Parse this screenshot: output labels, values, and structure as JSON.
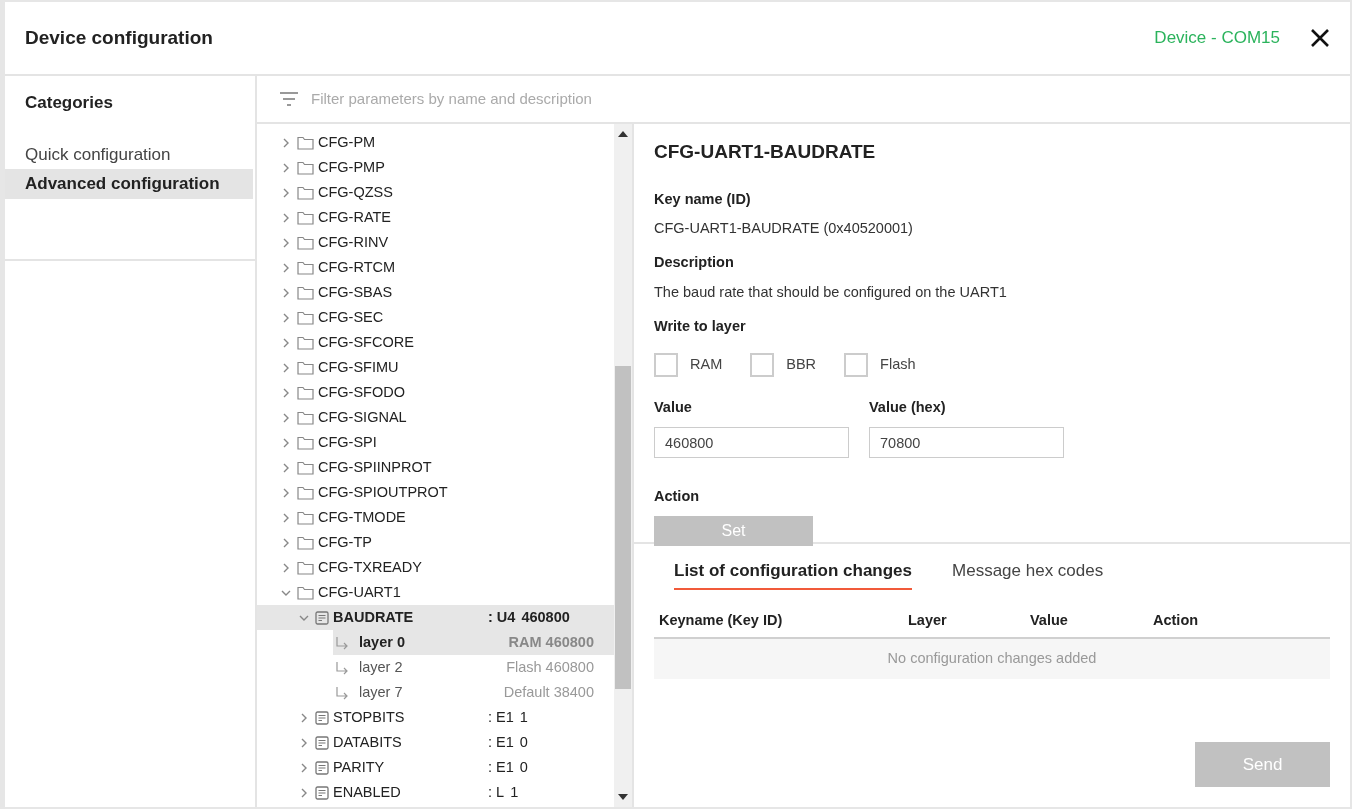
{
  "window": {
    "title": "Device configuration",
    "device": "Device - COM15"
  },
  "sidebar": {
    "title": "Categories",
    "items": [
      {
        "label": "Quick configuration",
        "selected": false
      },
      {
        "label": "Advanced configuration",
        "selected": true
      }
    ]
  },
  "filter": {
    "placeholder": "Filter parameters by name and description"
  },
  "tree": [
    {
      "kind": "folder",
      "label": "CFG-PM",
      "expanded": false
    },
    {
      "kind": "folder",
      "label": "CFG-PMP",
      "expanded": false
    },
    {
      "kind": "folder",
      "label": "CFG-QZSS",
      "expanded": false
    },
    {
      "kind": "folder",
      "label": "CFG-RATE",
      "expanded": false
    },
    {
      "kind": "folder",
      "label": "CFG-RINV",
      "expanded": false
    },
    {
      "kind": "folder",
      "label": "CFG-RTCM",
      "expanded": false
    },
    {
      "kind": "folder",
      "label": "CFG-SBAS",
      "expanded": false
    },
    {
      "kind": "folder",
      "label": "CFG-SEC",
      "expanded": false
    },
    {
      "kind": "folder",
      "label": "CFG-SFCORE",
      "expanded": false
    },
    {
      "kind": "folder",
      "label": "CFG-SFIMU",
      "expanded": false
    },
    {
      "kind": "folder",
      "label": "CFG-SFODO",
      "expanded": false
    },
    {
      "kind": "folder",
      "label": "CFG-SIGNAL",
      "expanded": false
    },
    {
      "kind": "folder",
      "label": "CFG-SPI",
      "expanded": false
    },
    {
      "kind": "folder",
      "label": "CFG-SPIINPROT",
      "expanded": false
    },
    {
      "kind": "folder",
      "label": "CFG-SPIOUTPROT",
      "expanded": false
    },
    {
      "kind": "folder",
      "label": "CFG-TMODE",
      "expanded": false
    },
    {
      "kind": "folder",
      "label": "CFG-TP",
      "expanded": false
    },
    {
      "kind": "folder",
      "label": "CFG-TXREADY",
      "expanded": false
    },
    {
      "kind": "folder",
      "label": "CFG-UART1",
      "expanded": true,
      "children": [
        {
          "kind": "key",
          "label": "BAUDRATE",
          "type": ": U4",
          "value": "460800",
          "expanded": true,
          "selected": true,
          "children": [
            {
              "kind": "layer",
              "label": "layer 0",
              "value": "RAM 460800",
              "selected": true
            },
            {
              "kind": "layer",
              "label": "layer 2",
              "value": "Flash 460800",
              "selected": false
            },
            {
              "kind": "layer",
              "label": "layer 7",
              "value": "Default 38400",
              "selected": false
            }
          ]
        },
        {
          "kind": "key",
          "label": "STOPBITS",
          "type": ": E1",
          "value": "1",
          "expanded": false,
          "selected": false
        },
        {
          "kind": "key",
          "label": "DATABITS",
          "type": ": E1",
          "value": "0",
          "expanded": false,
          "selected": false
        },
        {
          "kind": "key",
          "label": "PARITY",
          "type": ": E1",
          "value": "0",
          "expanded": false,
          "selected": false
        },
        {
          "kind": "key",
          "label": "ENABLED",
          "type": ": L",
          "value": "1",
          "expanded": false,
          "selected": false
        }
      ]
    }
  ],
  "detail": {
    "title": "CFG-UART1-BAUDRATE",
    "key_label": "Key name (ID)",
    "key_value": "CFG-UART1-BAUDRATE (0x40520001)",
    "description_label": "Description",
    "description": "The baud rate that should be configured on the UART1",
    "layer_label": "Write to layer",
    "layers": [
      {
        "label": "RAM",
        "checked": false
      },
      {
        "label": "BBR",
        "checked": false
      },
      {
        "label": "Flash",
        "checked": false
      }
    ],
    "fields": [
      {
        "label": "Value",
        "value": "460800"
      },
      {
        "label": "Value (hex)",
        "value": "70800"
      }
    ],
    "action_label": "Action",
    "action_button": {
      "label": "Set",
      "disabled": true
    }
  },
  "changes": {
    "tabs": [
      {
        "label": "List of configuration changes",
        "selected": true
      },
      {
        "label": "Message hex codes",
        "selected": false
      }
    ],
    "columns": [
      "Keyname (Key ID)",
      "Layer",
      "Value",
      "Action"
    ],
    "empty": "No configuration changes added",
    "send_button": {
      "label": "Send",
      "disabled": true
    }
  }
}
